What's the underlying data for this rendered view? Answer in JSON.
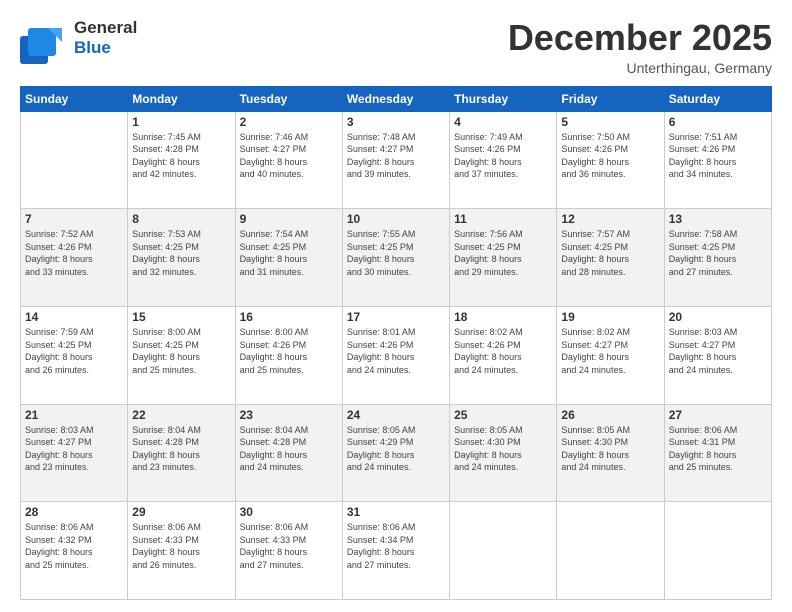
{
  "header": {
    "logo_general": "General",
    "logo_blue": "Blue",
    "month_title": "December 2025",
    "subtitle": "Unterthingau, Germany"
  },
  "calendar": {
    "headers": [
      "Sunday",
      "Monday",
      "Tuesday",
      "Wednesday",
      "Thursday",
      "Friday",
      "Saturday"
    ],
    "rows": [
      [
        {
          "day": "",
          "info": ""
        },
        {
          "day": "1",
          "info": "Sunrise: 7:45 AM\nSunset: 4:28 PM\nDaylight: 8 hours\nand 42 minutes."
        },
        {
          "day": "2",
          "info": "Sunrise: 7:46 AM\nSunset: 4:27 PM\nDaylight: 8 hours\nand 40 minutes."
        },
        {
          "day": "3",
          "info": "Sunrise: 7:48 AM\nSunset: 4:27 PM\nDaylight: 8 hours\nand 39 minutes."
        },
        {
          "day": "4",
          "info": "Sunrise: 7:49 AM\nSunset: 4:26 PM\nDaylight: 8 hours\nand 37 minutes."
        },
        {
          "day": "5",
          "info": "Sunrise: 7:50 AM\nSunset: 4:26 PM\nDaylight: 8 hours\nand 36 minutes."
        },
        {
          "day": "6",
          "info": "Sunrise: 7:51 AM\nSunset: 4:26 PM\nDaylight: 8 hours\nand 34 minutes."
        }
      ],
      [
        {
          "day": "7",
          "info": "Sunrise: 7:52 AM\nSunset: 4:26 PM\nDaylight: 8 hours\nand 33 minutes."
        },
        {
          "day": "8",
          "info": "Sunrise: 7:53 AM\nSunset: 4:25 PM\nDaylight: 8 hours\nand 32 minutes."
        },
        {
          "day": "9",
          "info": "Sunrise: 7:54 AM\nSunset: 4:25 PM\nDaylight: 8 hours\nand 31 minutes."
        },
        {
          "day": "10",
          "info": "Sunrise: 7:55 AM\nSunset: 4:25 PM\nDaylight: 8 hours\nand 30 minutes."
        },
        {
          "day": "11",
          "info": "Sunrise: 7:56 AM\nSunset: 4:25 PM\nDaylight: 8 hours\nand 29 minutes."
        },
        {
          "day": "12",
          "info": "Sunrise: 7:57 AM\nSunset: 4:25 PM\nDaylight: 8 hours\nand 28 minutes."
        },
        {
          "day": "13",
          "info": "Sunrise: 7:58 AM\nSunset: 4:25 PM\nDaylight: 8 hours\nand 27 minutes."
        }
      ],
      [
        {
          "day": "14",
          "info": "Sunrise: 7:59 AM\nSunset: 4:25 PM\nDaylight: 8 hours\nand 26 minutes."
        },
        {
          "day": "15",
          "info": "Sunrise: 8:00 AM\nSunset: 4:25 PM\nDaylight: 8 hours\nand 25 minutes."
        },
        {
          "day": "16",
          "info": "Sunrise: 8:00 AM\nSunset: 4:26 PM\nDaylight: 8 hours\nand 25 minutes."
        },
        {
          "day": "17",
          "info": "Sunrise: 8:01 AM\nSunset: 4:26 PM\nDaylight: 8 hours\nand 24 minutes."
        },
        {
          "day": "18",
          "info": "Sunrise: 8:02 AM\nSunset: 4:26 PM\nDaylight: 8 hours\nand 24 minutes."
        },
        {
          "day": "19",
          "info": "Sunrise: 8:02 AM\nSunset: 4:27 PM\nDaylight: 8 hours\nand 24 minutes."
        },
        {
          "day": "20",
          "info": "Sunrise: 8:03 AM\nSunset: 4:27 PM\nDaylight: 8 hours\nand 24 minutes."
        }
      ],
      [
        {
          "day": "21",
          "info": "Sunrise: 8:03 AM\nSunset: 4:27 PM\nDaylight: 8 hours\nand 23 minutes."
        },
        {
          "day": "22",
          "info": "Sunrise: 8:04 AM\nSunset: 4:28 PM\nDaylight: 8 hours\nand 23 minutes."
        },
        {
          "day": "23",
          "info": "Sunrise: 8:04 AM\nSunset: 4:28 PM\nDaylight: 8 hours\nand 24 minutes."
        },
        {
          "day": "24",
          "info": "Sunrise: 8:05 AM\nSunset: 4:29 PM\nDaylight: 8 hours\nand 24 minutes."
        },
        {
          "day": "25",
          "info": "Sunrise: 8:05 AM\nSunset: 4:30 PM\nDaylight: 8 hours\nand 24 minutes."
        },
        {
          "day": "26",
          "info": "Sunrise: 8:05 AM\nSunset: 4:30 PM\nDaylight: 8 hours\nand 24 minutes."
        },
        {
          "day": "27",
          "info": "Sunrise: 8:06 AM\nSunset: 4:31 PM\nDaylight: 8 hours\nand 25 minutes."
        }
      ],
      [
        {
          "day": "28",
          "info": "Sunrise: 8:06 AM\nSunset: 4:32 PM\nDaylight: 8 hours\nand 25 minutes."
        },
        {
          "day": "29",
          "info": "Sunrise: 8:06 AM\nSunset: 4:33 PM\nDaylight: 8 hours\nand 26 minutes."
        },
        {
          "day": "30",
          "info": "Sunrise: 8:06 AM\nSunset: 4:33 PM\nDaylight: 8 hours\nand 27 minutes."
        },
        {
          "day": "31",
          "info": "Sunrise: 8:06 AM\nSunset: 4:34 PM\nDaylight: 8 hours\nand 27 minutes."
        },
        {
          "day": "",
          "info": ""
        },
        {
          "day": "",
          "info": ""
        },
        {
          "day": "",
          "info": ""
        }
      ]
    ]
  }
}
